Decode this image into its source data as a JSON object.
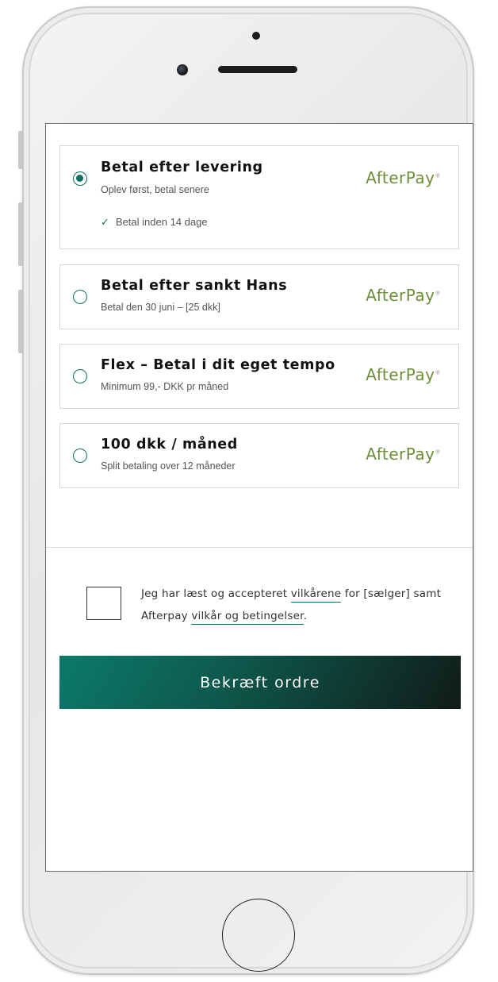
{
  "options": [
    {
      "title": "Betal efter levering",
      "subtitle": "Oplev først, betal senere",
      "detail": "Betal inden 14 dage",
      "selected": true,
      "provider": "AfterPay"
    },
    {
      "title": "Betal efter sankt Hans",
      "subtitle": "Betal den 30 juni – [25 dkk]",
      "selected": false,
      "provider": "AfterPay"
    },
    {
      "title": "Flex – Betal i dit eget tempo",
      "subtitle": "Minimum 99,- DKK pr måned",
      "selected": false,
      "provider": "AfterPay"
    },
    {
      "title": "100 dkk / måned",
      "subtitle": "Split betaling over 12 måneder",
      "selected": false,
      "provider": "AfterPay"
    }
  ],
  "terms": {
    "part1": "Jeg har læst og accepteret ",
    "link1": "vilkårene",
    "part2": " for [sælger] samt Afterpay ",
    "link2": "vilkår og betingelser",
    "part3": ".",
    "checked": false
  },
  "confirm_label": "Bekræft ordre",
  "colors": {
    "accent": "#11705f",
    "logo": "#6d8f3c"
  },
  "icons": {
    "check": "checkmark-icon",
    "radio_selected": "radio-selected-icon",
    "radio_unselected": "radio-unselected-icon"
  }
}
